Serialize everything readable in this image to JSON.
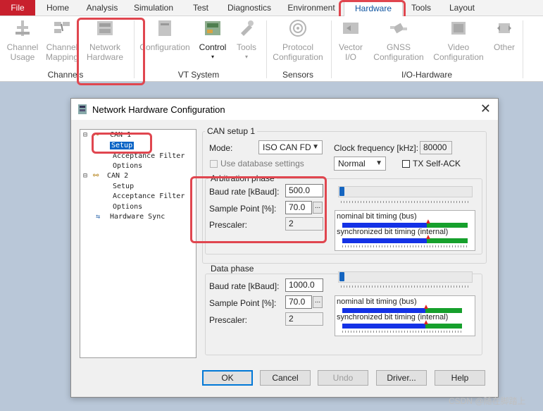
{
  "ribbon": {
    "tabs": [
      "File",
      "Home",
      "Analysis",
      "Simulation",
      "Test",
      "Diagnostics",
      "Environment",
      "Hardware",
      "Tools",
      "Layout"
    ],
    "active_tab": "Hardware",
    "buttons": {
      "channel_usage": [
        "Channel",
        "Usage"
      ],
      "channel_mapping": [
        "Channel",
        "Mapping"
      ],
      "network_hardware": [
        "Network",
        "Hardware"
      ],
      "configuration": "Configuration",
      "control": "Control",
      "tools": "Tools",
      "protocol_configuration": [
        "Protocol",
        "Configuration"
      ],
      "vector_io": [
        "Vector",
        "I/O"
      ],
      "gnss_configuration": [
        "GNSS",
        "Configuration"
      ],
      "video_configuration": [
        "Video",
        "Configuration"
      ],
      "other": "Other"
    },
    "groups": [
      "Channels",
      "VT System",
      "Sensors",
      "I/O-Hardware"
    ]
  },
  "dialog": {
    "title": "Network Hardware Configuration",
    "close": "✕",
    "tree": [
      {
        "label": "CAN 1",
        "level": 0
      },
      {
        "label": "Setup",
        "level": 1,
        "selected": true
      },
      {
        "label": "Acceptance Filter",
        "level": 1
      },
      {
        "label": "Options",
        "level": 1
      },
      {
        "label": "CAN 2",
        "level": 0
      },
      {
        "label": "Setup",
        "level": 1
      },
      {
        "label": "Acceptance Filter",
        "level": 1
      },
      {
        "label": "Options",
        "level": 1
      },
      {
        "label": "Hardware Sync",
        "level": 0
      }
    ],
    "setup_group": "CAN setup 1",
    "mode_label": "Mode:",
    "mode_value": "ISO CAN FD",
    "clock_label": "Clock frequency [kHz]:",
    "clock_value": "80000",
    "use_db_label": "Use database settings",
    "normal_value": "Normal",
    "tx_self_ack": "TX Self-ACK",
    "arbitration": {
      "title": "Arbitration phase",
      "baud_label": "Baud rate [kBaud]:",
      "baud_value": "500.0",
      "sp_label": "Sample Point [%]:",
      "sp_value": "70.0",
      "prescaler_label": "Prescaler:",
      "prescaler_value": "2",
      "nominal_label": "nominal bit timing (bus)",
      "sync_label": "synchronized bit timing (internal)"
    },
    "data_phase": {
      "title": "Data phase",
      "baud_label": "Baud rate [kBaud]:",
      "baud_value": "1000.0",
      "sp_label": "Sample Point [%]:",
      "sp_value": "70.0",
      "prescaler_label": "Prescaler:",
      "prescaler_value": "2",
      "nominal_label": "nominal bit timing (bus)",
      "sync_label": "synchronized bit timing (internal)"
    },
    "buttons": {
      "ok": "OK",
      "cancel": "Cancel",
      "undo": "Undo",
      "driver": "Driver...",
      "help": "Help"
    }
  },
  "watermark": "CSDN @随在脚踏上",
  "colors": {
    "accent_red": "#e0464f",
    "file_tab": "#c8202d",
    "selection": "#0a64c6"
  }
}
